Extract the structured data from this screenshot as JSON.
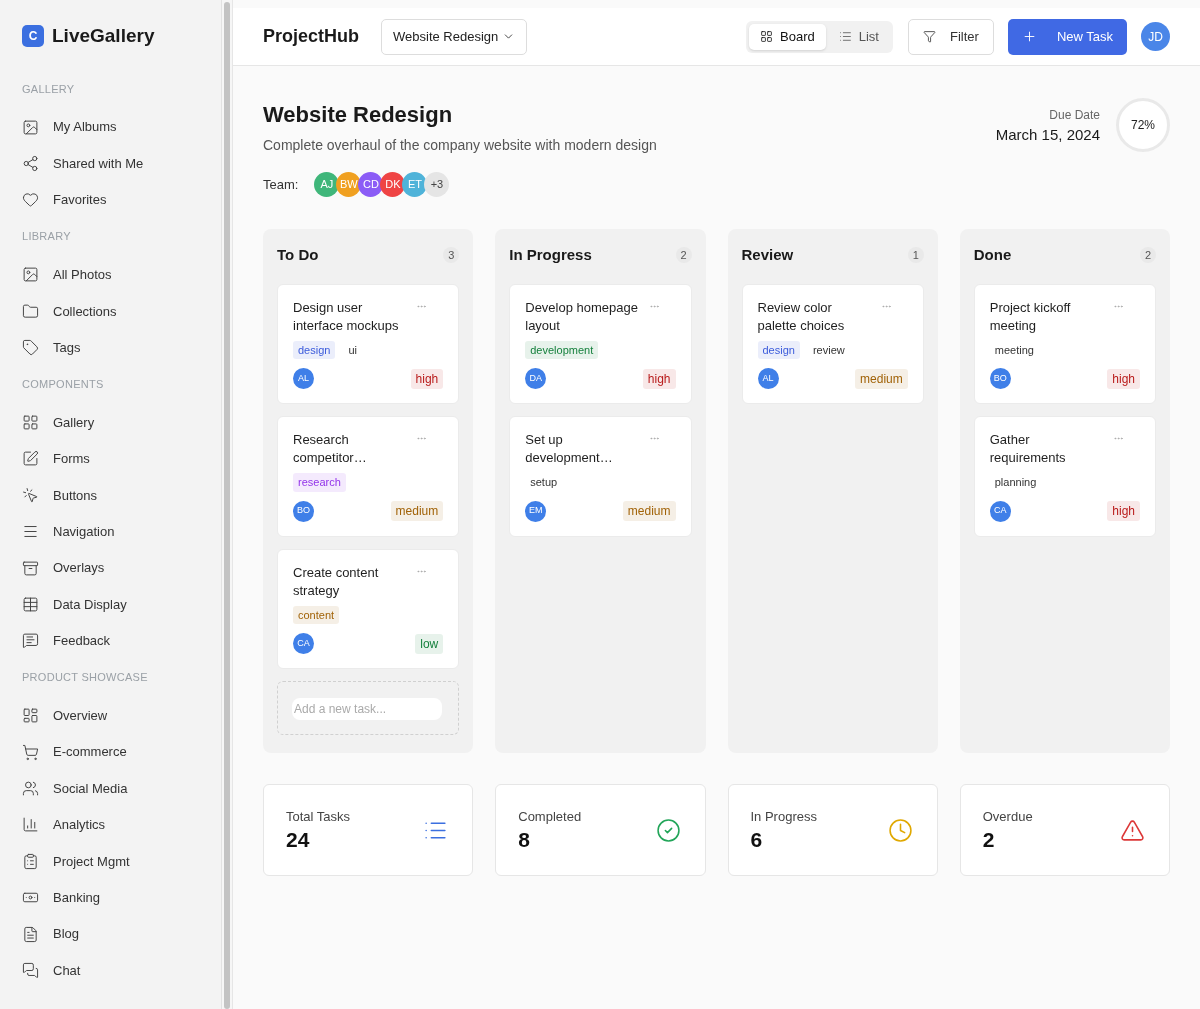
{
  "sidebar": {
    "brand": "LiveGallery",
    "logo_letter": "C",
    "sections": [
      {
        "title": "GALLERY",
        "items": [
          "My Albums",
          "Shared with Me",
          "Favorites"
        ]
      },
      {
        "title": "LIBRARY",
        "items": [
          "All Photos",
          "Collections",
          "Tags"
        ]
      },
      {
        "title": "COMPONENTS",
        "items": [
          "Gallery",
          "Forms",
          "Buttons",
          "Navigation",
          "Overlays",
          "Data Display",
          "Feedback"
        ]
      },
      {
        "title": "PRODUCT SHOWCASE",
        "items": [
          "Overview",
          "E-commerce",
          "Social Media",
          "Analytics",
          "Project Mgmt",
          "Banking",
          "Blog",
          "Chat"
        ]
      }
    ]
  },
  "header": {
    "app_title": "ProjectHub",
    "project_select": "Website Redesign",
    "views": [
      {
        "label": "Board",
        "selected": true
      },
      {
        "label": "List",
        "selected": false
      }
    ],
    "filter": "Filter",
    "new_task": "New Task",
    "user": "JD"
  },
  "project": {
    "title": "Website Redesign",
    "description": "Complete overhaul of the company website with modern design",
    "due_label": "Due Date",
    "due_date": "March 15, 2024",
    "progress": "72%",
    "team_label": "Team:",
    "team": [
      {
        "initials": "AJ",
        "color": "#3fb67a"
      },
      {
        "initials": "BW",
        "color": "#f0a020"
      },
      {
        "initials": "CD",
        "color": "#8b5cf6"
      },
      {
        "initials": "DK",
        "color": "#ef4444"
      },
      {
        "initials": "ET",
        "color": "#4fb3d9"
      }
    ],
    "team_more": "+3"
  },
  "columns": [
    {
      "title": "To Do",
      "count": "3",
      "tasks": [
        {
          "title": "Design user interface mockups",
          "tags": [
            {
              "label": "design",
              "color": "#3b5bdb"
            },
            {
              "label": "ui"
            }
          ],
          "assignee": "AL",
          "priority": {
            "label": "high",
            "color": "#b91c1c"
          }
        },
        {
          "title": "Research competitor…",
          "tags": [
            {
              "label": "research",
              "color": "#9333ea"
            }
          ],
          "assignee": "BO",
          "priority": {
            "label": "medium",
            "color": "#a16207"
          }
        },
        {
          "title": "Create content strategy",
          "tags": [
            {
              "label": "content",
              "color": "#a16207"
            }
          ],
          "assignee": "CA",
          "priority": {
            "label": "low",
            "color": "#15803d"
          }
        }
      ],
      "add_placeholder": "Add a new task..."
    },
    {
      "title": "In Progress",
      "count": "2",
      "tasks": [
        {
          "title": "Develop homepage layout",
          "tags": [
            {
              "label": "development",
              "color": "#15803d"
            }
          ],
          "assignee": "DA",
          "priority": {
            "label": "high",
            "color": "#b91c1c"
          }
        },
        {
          "title": "Set up development…",
          "tags": [
            {
              "label": "setup"
            }
          ],
          "assignee": "EM",
          "priority": {
            "label": "medium",
            "color": "#a16207"
          }
        }
      ]
    },
    {
      "title": "Review",
      "count": "1",
      "tasks": [
        {
          "title": "Review color palette choices",
          "tags": [
            {
              "label": "design",
              "color": "#3b5bdb"
            },
            {
              "label": "review"
            }
          ],
          "assignee": "AL",
          "priority": {
            "label": "medium",
            "color": "#a16207"
          }
        }
      ]
    },
    {
      "title": "Done",
      "count": "2",
      "tasks": [
        {
          "title": "Project kickoff meeting",
          "tags": [
            {
              "label": "meeting"
            }
          ],
          "assignee": "BO",
          "priority": {
            "label": "high",
            "color": "#b91c1c"
          }
        },
        {
          "title": "Gather requirements",
          "tags": [
            {
              "label": "planning"
            }
          ],
          "assignee": "CA",
          "priority": {
            "label": "high",
            "color": "#b91c1c"
          }
        }
      ]
    }
  ],
  "stats": [
    {
      "label": "Total Tasks",
      "value": "24",
      "kind": "list"
    },
    {
      "label": "Completed",
      "value": "8",
      "kind": "done"
    },
    {
      "label": "In Progress",
      "value": "6",
      "kind": "time"
    },
    {
      "label": "Overdue",
      "value": "2",
      "kind": "alert"
    }
  ]
}
